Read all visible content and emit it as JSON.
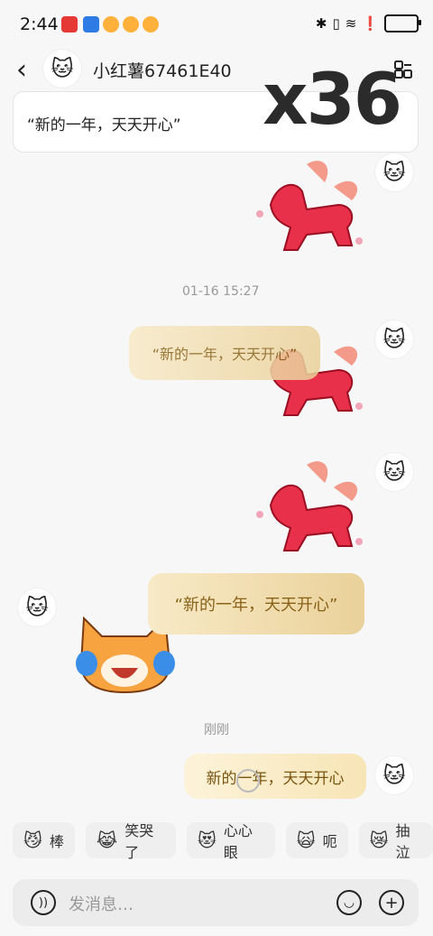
{
  "status_bar": {
    "time": "2:44"
  },
  "header": {
    "contact_name": "小红薯67461E40"
  },
  "pinned": {
    "text": "“新的一年，天天开心”"
  },
  "overlay": {
    "counter": "x36"
  },
  "messages": {
    "timestamp_1": "01-16 15:27",
    "bubble_1": "“新的一年，天天开心”",
    "bubble_2": "“新的一年，天天开心”",
    "timestamp_2": "刚刚",
    "bubble_3": "新的一年，天天开心"
  },
  "quick_replies": [
    {
      "label": "棒",
      "icon": "cat-thumbs-icon"
    },
    {
      "label": "笑哭了",
      "icon": "cat-laugh-cry-icon"
    },
    {
      "label": "心心眼",
      "icon": "cat-heart-eyes-icon"
    },
    {
      "label": "呃",
      "icon": "cat-awkward-icon"
    },
    {
      "label": "抽泣",
      "icon": "cat-sob-icon"
    }
  ],
  "composer": {
    "placeholder": "发消息…"
  },
  "colors": {
    "accent_gold": "#ead19a",
    "gold_text": "#8a6218",
    "bg": "#f7f7f7"
  }
}
